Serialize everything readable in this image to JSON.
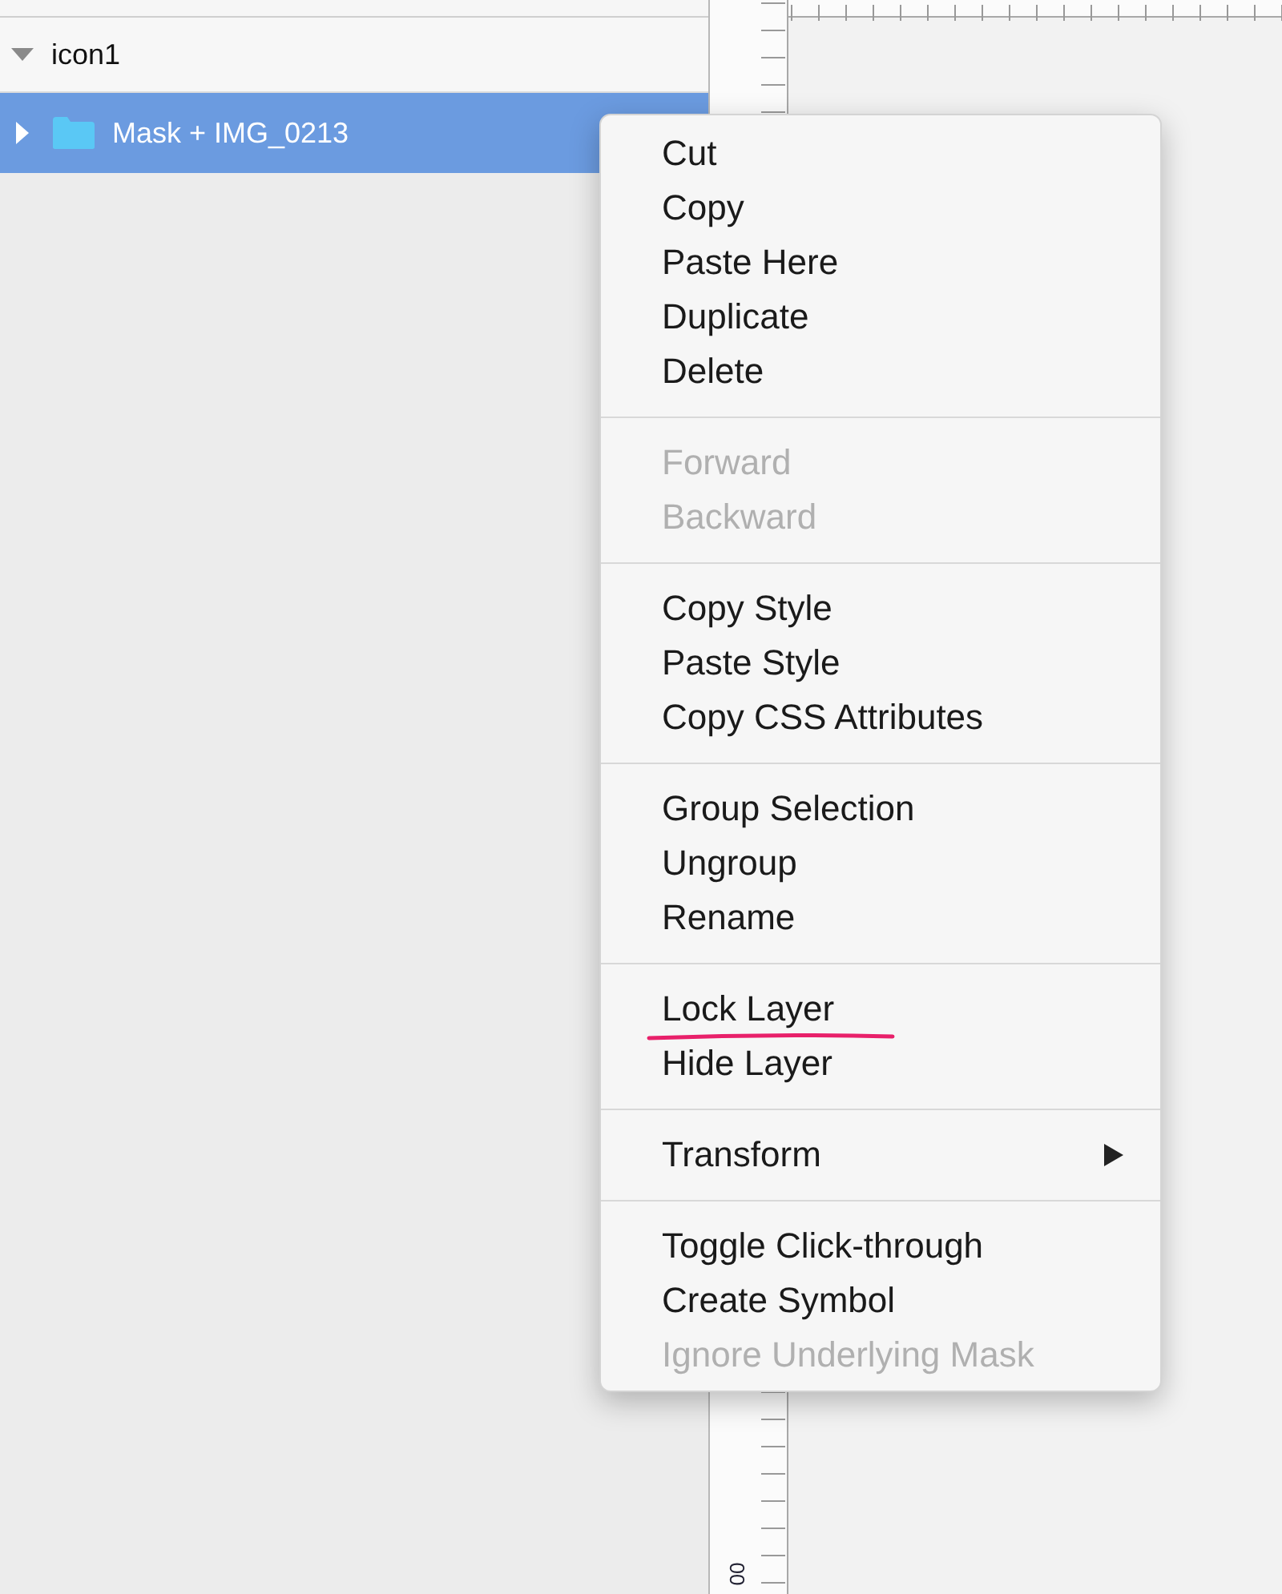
{
  "layers": [
    {
      "name": "icon1",
      "expanded": true,
      "selected": false,
      "kind": "group"
    },
    {
      "name": "Mask + IMG_0213",
      "expanded": false,
      "selected": true,
      "kind": "folder"
    }
  ],
  "ruler": {
    "label": "00"
  },
  "context_menu": {
    "groups": [
      [
        {
          "label": "Cut",
          "disabled": false,
          "kind": "action",
          "underlined": false
        },
        {
          "label": "Copy",
          "disabled": false,
          "kind": "action",
          "underlined": false
        },
        {
          "label": "Paste Here",
          "disabled": false,
          "kind": "action",
          "underlined": false
        },
        {
          "label": "Duplicate",
          "disabled": false,
          "kind": "action",
          "underlined": false
        },
        {
          "label": "Delete",
          "disabled": false,
          "kind": "action",
          "underlined": false
        }
      ],
      [
        {
          "label": "Forward",
          "disabled": true,
          "kind": "action",
          "underlined": false
        },
        {
          "label": "Backward",
          "disabled": true,
          "kind": "action",
          "underlined": false
        }
      ],
      [
        {
          "label": "Copy Style",
          "disabled": false,
          "kind": "action",
          "underlined": false
        },
        {
          "label": "Paste Style",
          "disabled": false,
          "kind": "action",
          "underlined": false
        },
        {
          "label": "Copy CSS Attributes",
          "disabled": false,
          "kind": "action",
          "underlined": false
        }
      ],
      [
        {
          "label": "Group Selection",
          "disabled": false,
          "kind": "action",
          "underlined": false
        },
        {
          "label": "Ungroup",
          "disabled": false,
          "kind": "action",
          "underlined": false
        },
        {
          "label": "Rename",
          "disabled": false,
          "kind": "action",
          "underlined": false
        }
      ],
      [
        {
          "label": "Lock Layer",
          "disabled": false,
          "kind": "action",
          "underlined": true
        },
        {
          "label": "Hide Layer",
          "disabled": false,
          "kind": "action",
          "underlined": false
        }
      ],
      [
        {
          "label": "Transform",
          "disabled": false,
          "kind": "submenu",
          "underlined": false
        }
      ],
      [
        {
          "label": "Toggle Click-through",
          "disabled": false,
          "kind": "action",
          "underlined": false
        },
        {
          "label": "Create Symbol",
          "disabled": false,
          "kind": "action",
          "underlined": false
        },
        {
          "label": "Ignore Underlying Mask",
          "disabled": true,
          "kind": "action",
          "underlined": false
        }
      ]
    ]
  }
}
